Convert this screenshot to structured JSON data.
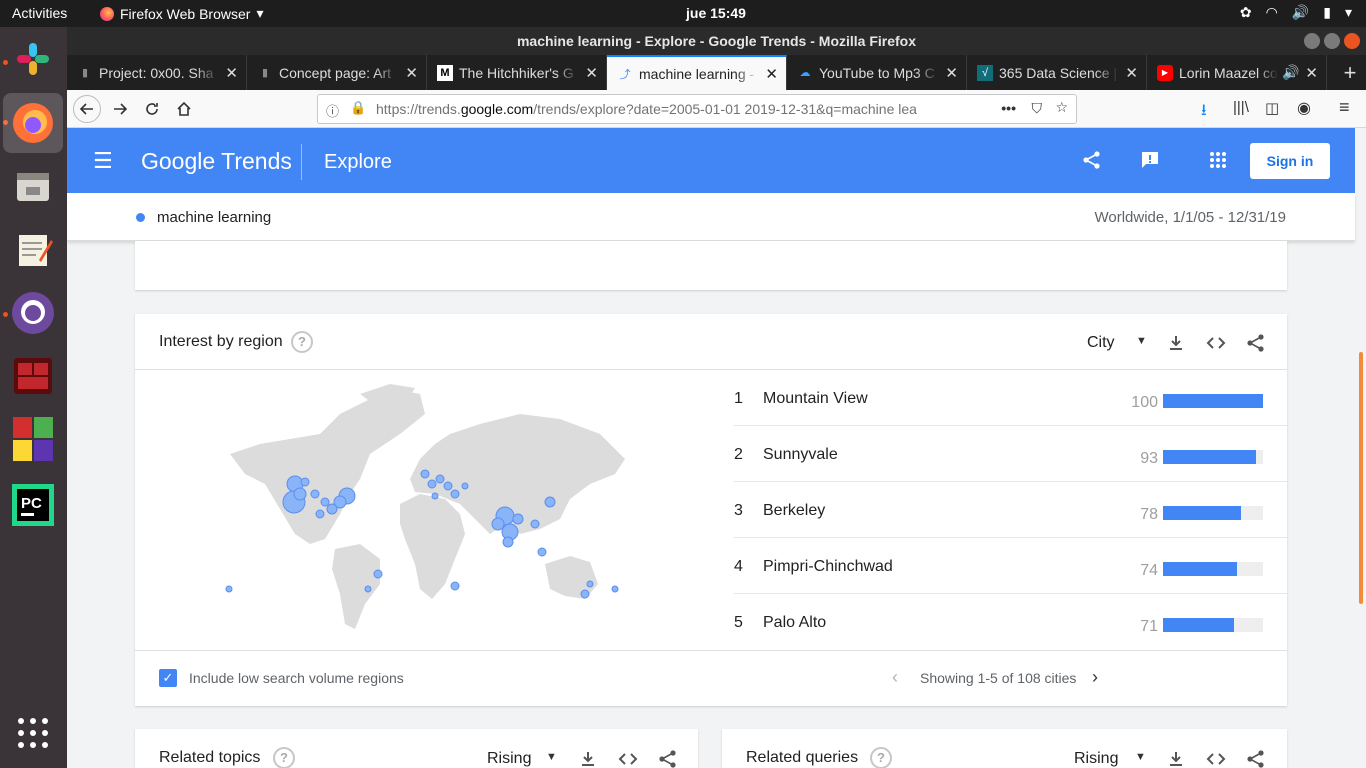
{
  "system": {
    "activities": "Activities",
    "app_name": "Firefox Web Browser",
    "clock": "jue 15:49"
  },
  "window": {
    "title": "machine learning - Explore - Google Trends - Mozilla Firefox"
  },
  "tabs": [
    {
      "label": "Project: 0x00. Sha"
    },
    {
      "label": "Concept page: Art"
    },
    {
      "label": "The Hitchhiker's G"
    },
    {
      "label": "machine learning -"
    },
    {
      "label": "YouTube to Mp3 C"
    },
    {
      "label": "365 Data Science |"
    },
    {
      "label": "Lorin Maazel co"
    }
  ],
  "url": {
    "prefix": "https://trends.",
    "domain": "google.com",
    "rest": "/trends/explore?date=2005-01-01 2019-12-31&q=machine lea"
  },
  "header": {
    "logo": "Google Trends",
    "section": "Explore",
    "signin": "Sign in"
  },
  "query": {
    "term": "machine learning",
    "range": "Worldwide, 1/1/05 - 12/31/19"
  },
  "region": {
    "title": "Interest by region",
    "help": "?",
    "resolution": "City",
    "rows": [
      {
        "rank": "1",
        "name": "Mountain View",
        "value": "100",
        "pct": 100
      },
      {
        "rank": "2",
        "name": "Sunnyvale",
        "value": "93",
        "pct": 93
      },
      {
        "rank": "3",
        "name": "Berkeley",
        "value": "78",
        "pct": 78
      },
      {
        "rank": "4",
        "name": "Pimpri-Chinchwad",
        "value": "74",
        "pct": 74
      },
      {
        "rank": "5",
        "name": "Palo Alto",
        "value": "71",
        "pct": 71
      }
    ],
    "checkbox_label": "Include low search volume regions",
    "pager": "Showing 1-5 of 108 cities"
  },
  "topics": {
    "title": "Related topics",
    "filter": "Rising",
    "help": "?"
  },
  "queries": {
    "title": "Related queries",
    "filter": "Rising",
    "help": "?"
  },
  "colors": {
    "accent": "#4285f4",
    "bar_track": "#eeeeee"
  }
}
